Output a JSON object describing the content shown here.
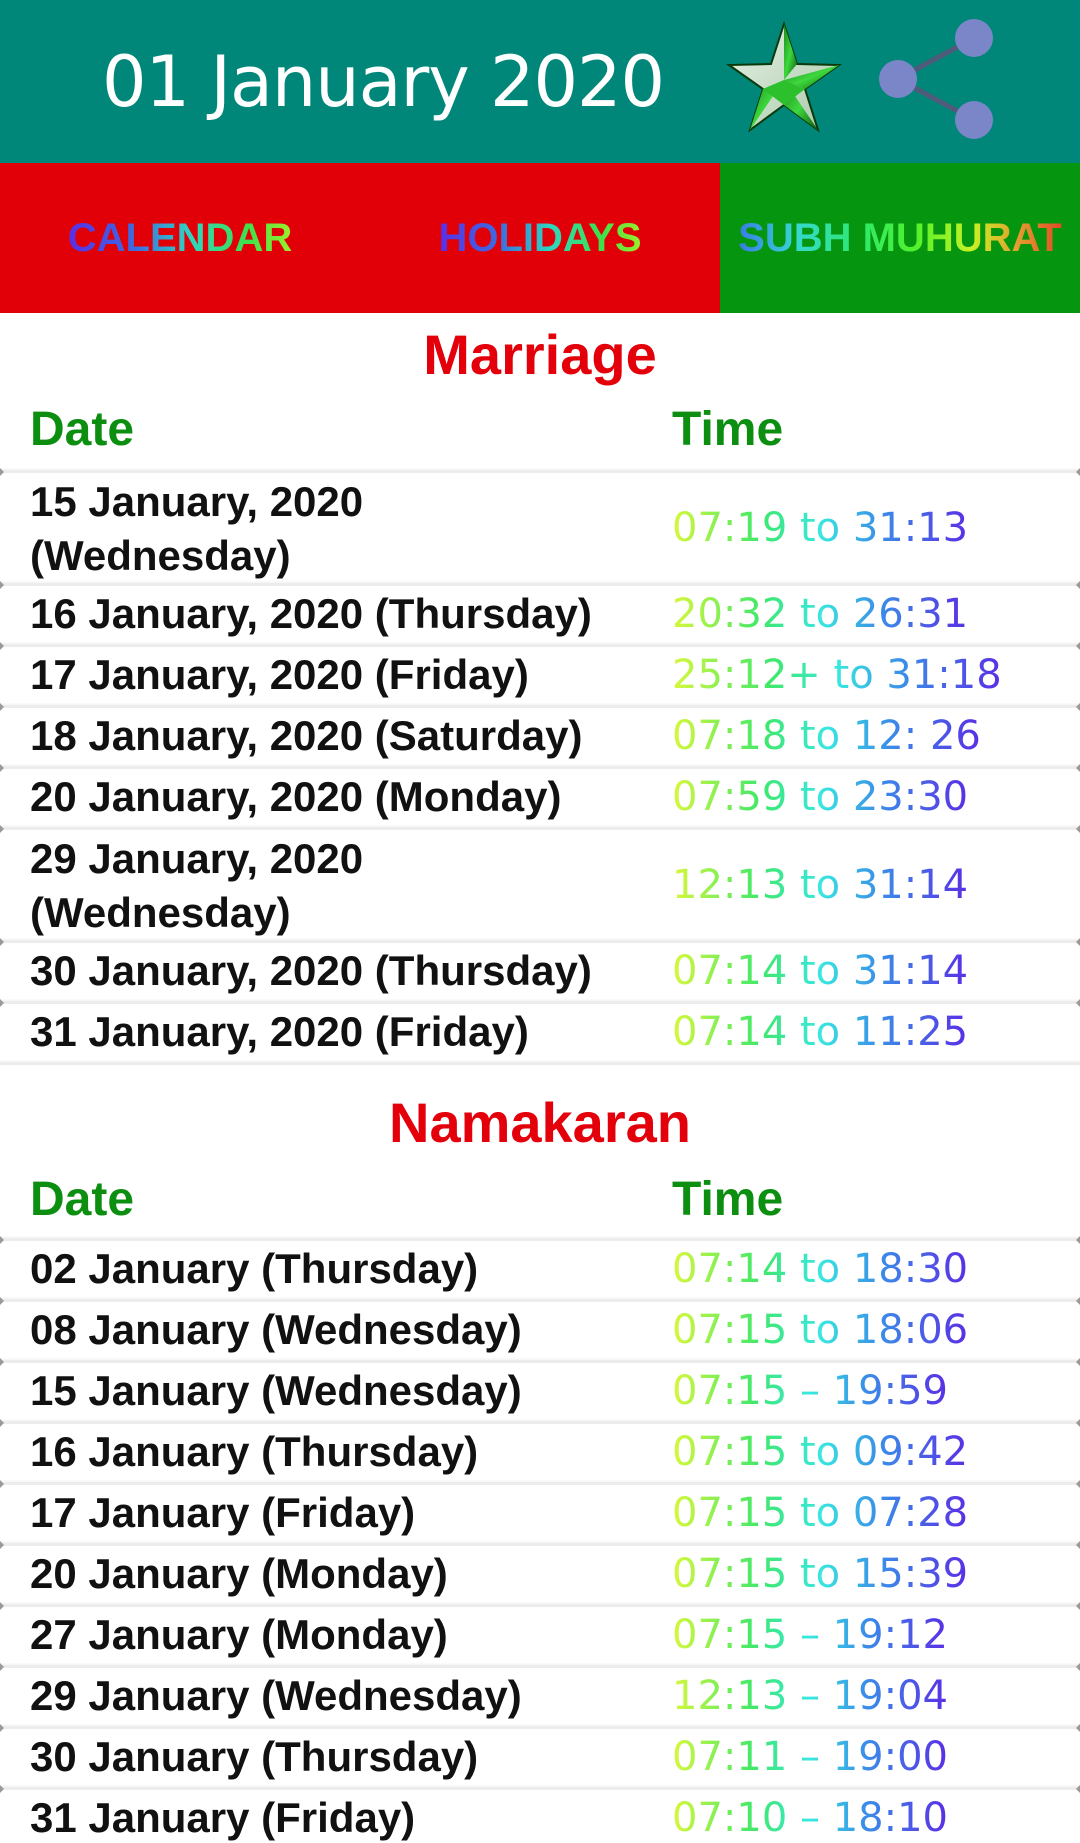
{
  "appbar": {
    "title": "01 January 2020",
    "actions": [
      {
        "name": "star-icon",
        "label": "Rate"
      },
      {
        "name": "share-icon",
        "label": "Share"
      }
    ],
    "background_color": "#00877a"
  },
  "tabs": [
    {
      "label": "CALENDAR",
      "background_color": "#e20008",
      "active": false
    },
    {
      "label": "HOLIDAYS",
      "background_color": "#e20008",
      "active": false
    },
    {
      "label": "SUBH MUHURAT",
      "background_color": "#06950f",
      "active": true
    }
  ],
  "sections": [
    {
      "title": "Marriage",
      "headers": {
        "date": "Date",
        "time": "Time"
      },
      "rows": [
        {
          "date": "15 January, 2020 (Wednesday)",
          "time": "07:19 to 31:13"
        },
        {
          "date": "16 January, 2020 (Thursday)",
          "time": "20:32 to 26:31"
        },
        {
          "date": "17 January, 2020 (Friday)",
          "time": "25:12+ to 31:18"
        },
        {
          "date": "18 January, 2020 (Saturday)",
          "time": "07:18 to 12: 26"
        },
        {
          "date": "20 January, 2020 (Monday)",
          "time": "07:59 to 23:30"
        },
        {
          "date": "29 January, 2020 (Wednesday)",
          "time": "12:13 to 31:14"
        },
        {
          "date": "30 January, 2020 (Thursday)",
          "time": "07:14 to 31:14"
        },
        {
          "date": "31 January, 2020 (Friday)",
          "time": "07:14 to 11:25"
        }
      ]
    },
    {
      "title": "Namakaran",
      "headers": {
        "date": "Date",
        "time": "Time"
      },
      "rows": [
        {
          "date": "02 January (Thursday)",
          "time": "07:14 to 18:30"
        },
        {
          "date": "08 January (Wednesday)",
          "time": "07:15 to 18:06"
        },
        {
          "date": "15 January (Wednesday)",
          "time": "07:15 – 19:59"
        },
        {
          "date": "16 January (Thursday)",
          "time": "07:15 to 09:42"
        },
        {
          "date": "17 January (Friday)",
          "time": "07:15 to 07:28"
        },
        {
          "date": "20 January (Monday)",
          "time": "07:15 to 15:39"
        },
        {
          "date": "27 January (Monday)",
          "time": "07:15 – 19:12"
        },
        {
          "date": "29 January (Wednesday)",
          "time": "12:13 – 19:04"
        },
        {
          "date": "30 January (Thursday)",
          "time": "07:11 – 19:00"
        },
        {
          "date": "31 January (Friday)",
          "time": "07:10 – 18:10"
        }
      ]
    }
  ],
  "colors": {
    "section_title": "#e3000b",
    "column_header": "#0c8f10",
    "date_text": "#111111"
  }
}
